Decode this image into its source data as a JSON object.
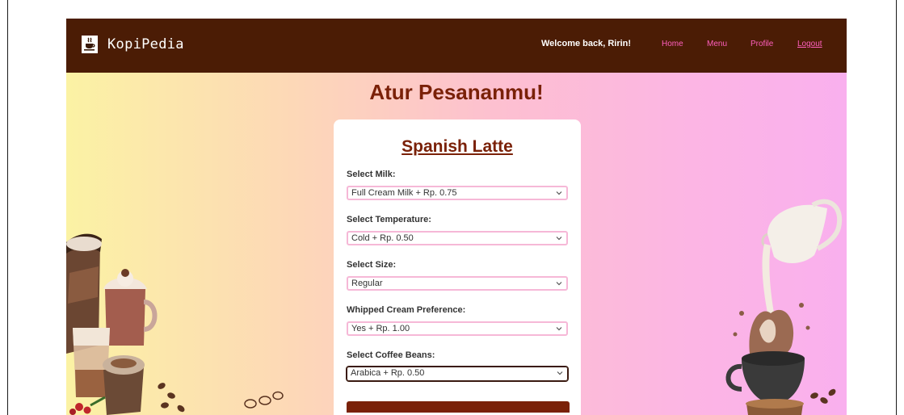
{
  "app": {
    "brand_name": "KopiPedia",
    "logo_icon": "coffee-cup-icon"
  },
  "navbar": {
    "welcome_text": "Welcome back, Ririn!",
    "links": [
      {
        "label": "Home"
      },
      {
        "label": "Menu"
      },
      {
        "label": "Profile"
      },
      {
        "label": "Logout"
      }
    ]
  },
  "page": {
    "heading": "Atur Pesananmu!"
  },
  "order_form": {
    "product_name": "Spanish Latte",
    "fields": [
      {
        "label": "Select Milk:",
        "selected": "Full Cream Milk + Rp. 0.75"
      },
      {
        "label": "Select Temperature:",
        "selected": "Cold + Rp. 0.50"
      },
      {
        "label": "Select Size:",
        "selected": "Regular"
      },
      {
        "label": "Whipped Cream Preference:",
        "selected": "Yes + Rp. 1.00"
      },
      {
        "label": "Select Coffee Beans:",
        "selected": "Arabica + Rp. 0.50"
      }
    ]
  },
  "colors": {
    "navbar_bg": "#4b1c05",
    "accent_brown": "#7a2108",
    "link_pink": "#ff5fbe",
    "select_border": "#f6b8d7"
  }
}
